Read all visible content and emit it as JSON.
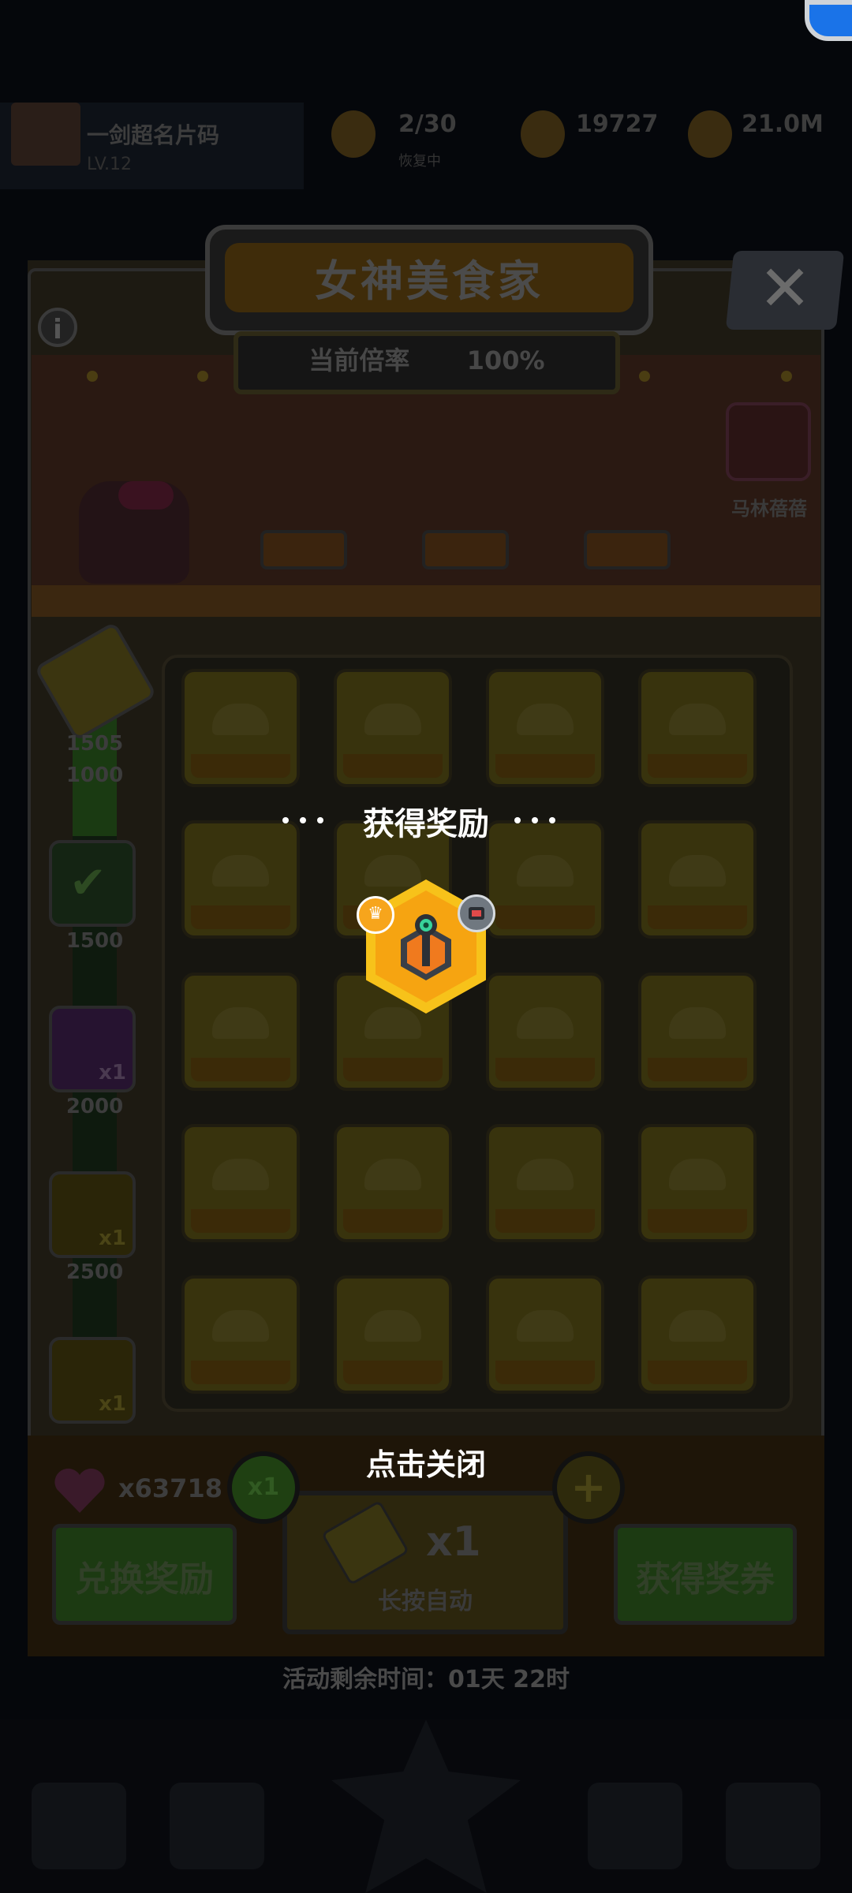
{
  "hud": {
    "player_name": "一剑超名片码",
    "player_sub": "LV.12",
    "stat_energy": "2/30",
    "stat_energy_sub": "恢复中",
    "stat_gems": "19727",
    "stat_coins": "21.0M"
  },
  "panel": {
    "title": "女神美食家",
    "rate_label": "当前倍率",
    "rate_value": "100%",
    "npc_name": "马林蓓蓓"
  },
  "progress": {
    "current": "1505",
    "milestones": [
      "1000",
      "1500",
      "2000",
      "2500"
    ],
    "reward_multipliers": [
      "x1",
      "x1",
      "x1"
    ]
  },
  "grid": {
    "rows": 5,
    "cols": 4
  },
  "bottom": {
    "heart_count": "x63718",
    "exchange_label": "兑换奖励",
    "obtain_label": "获得奖券",
    "multiplier_badge": "x1",
    "plus_badge": "+",
    "draw_count": "x1",
    "draw_auto": "长按自动",
    "remaining_time": "活动剩余时间：01天 22时"
  },
  "overlay": {
    "reward_title": "获得奖励",
    "tap_to_close": "点击关闭",
    "reward_item_icon": "hex-robot-turret-icon"
  },
  "colors": {
    "reward_hex_outer": "#f7c21a",
    "reward_hex_inner": "#f6a411",
    "overlay_text": "#ffffff"
  }
}
